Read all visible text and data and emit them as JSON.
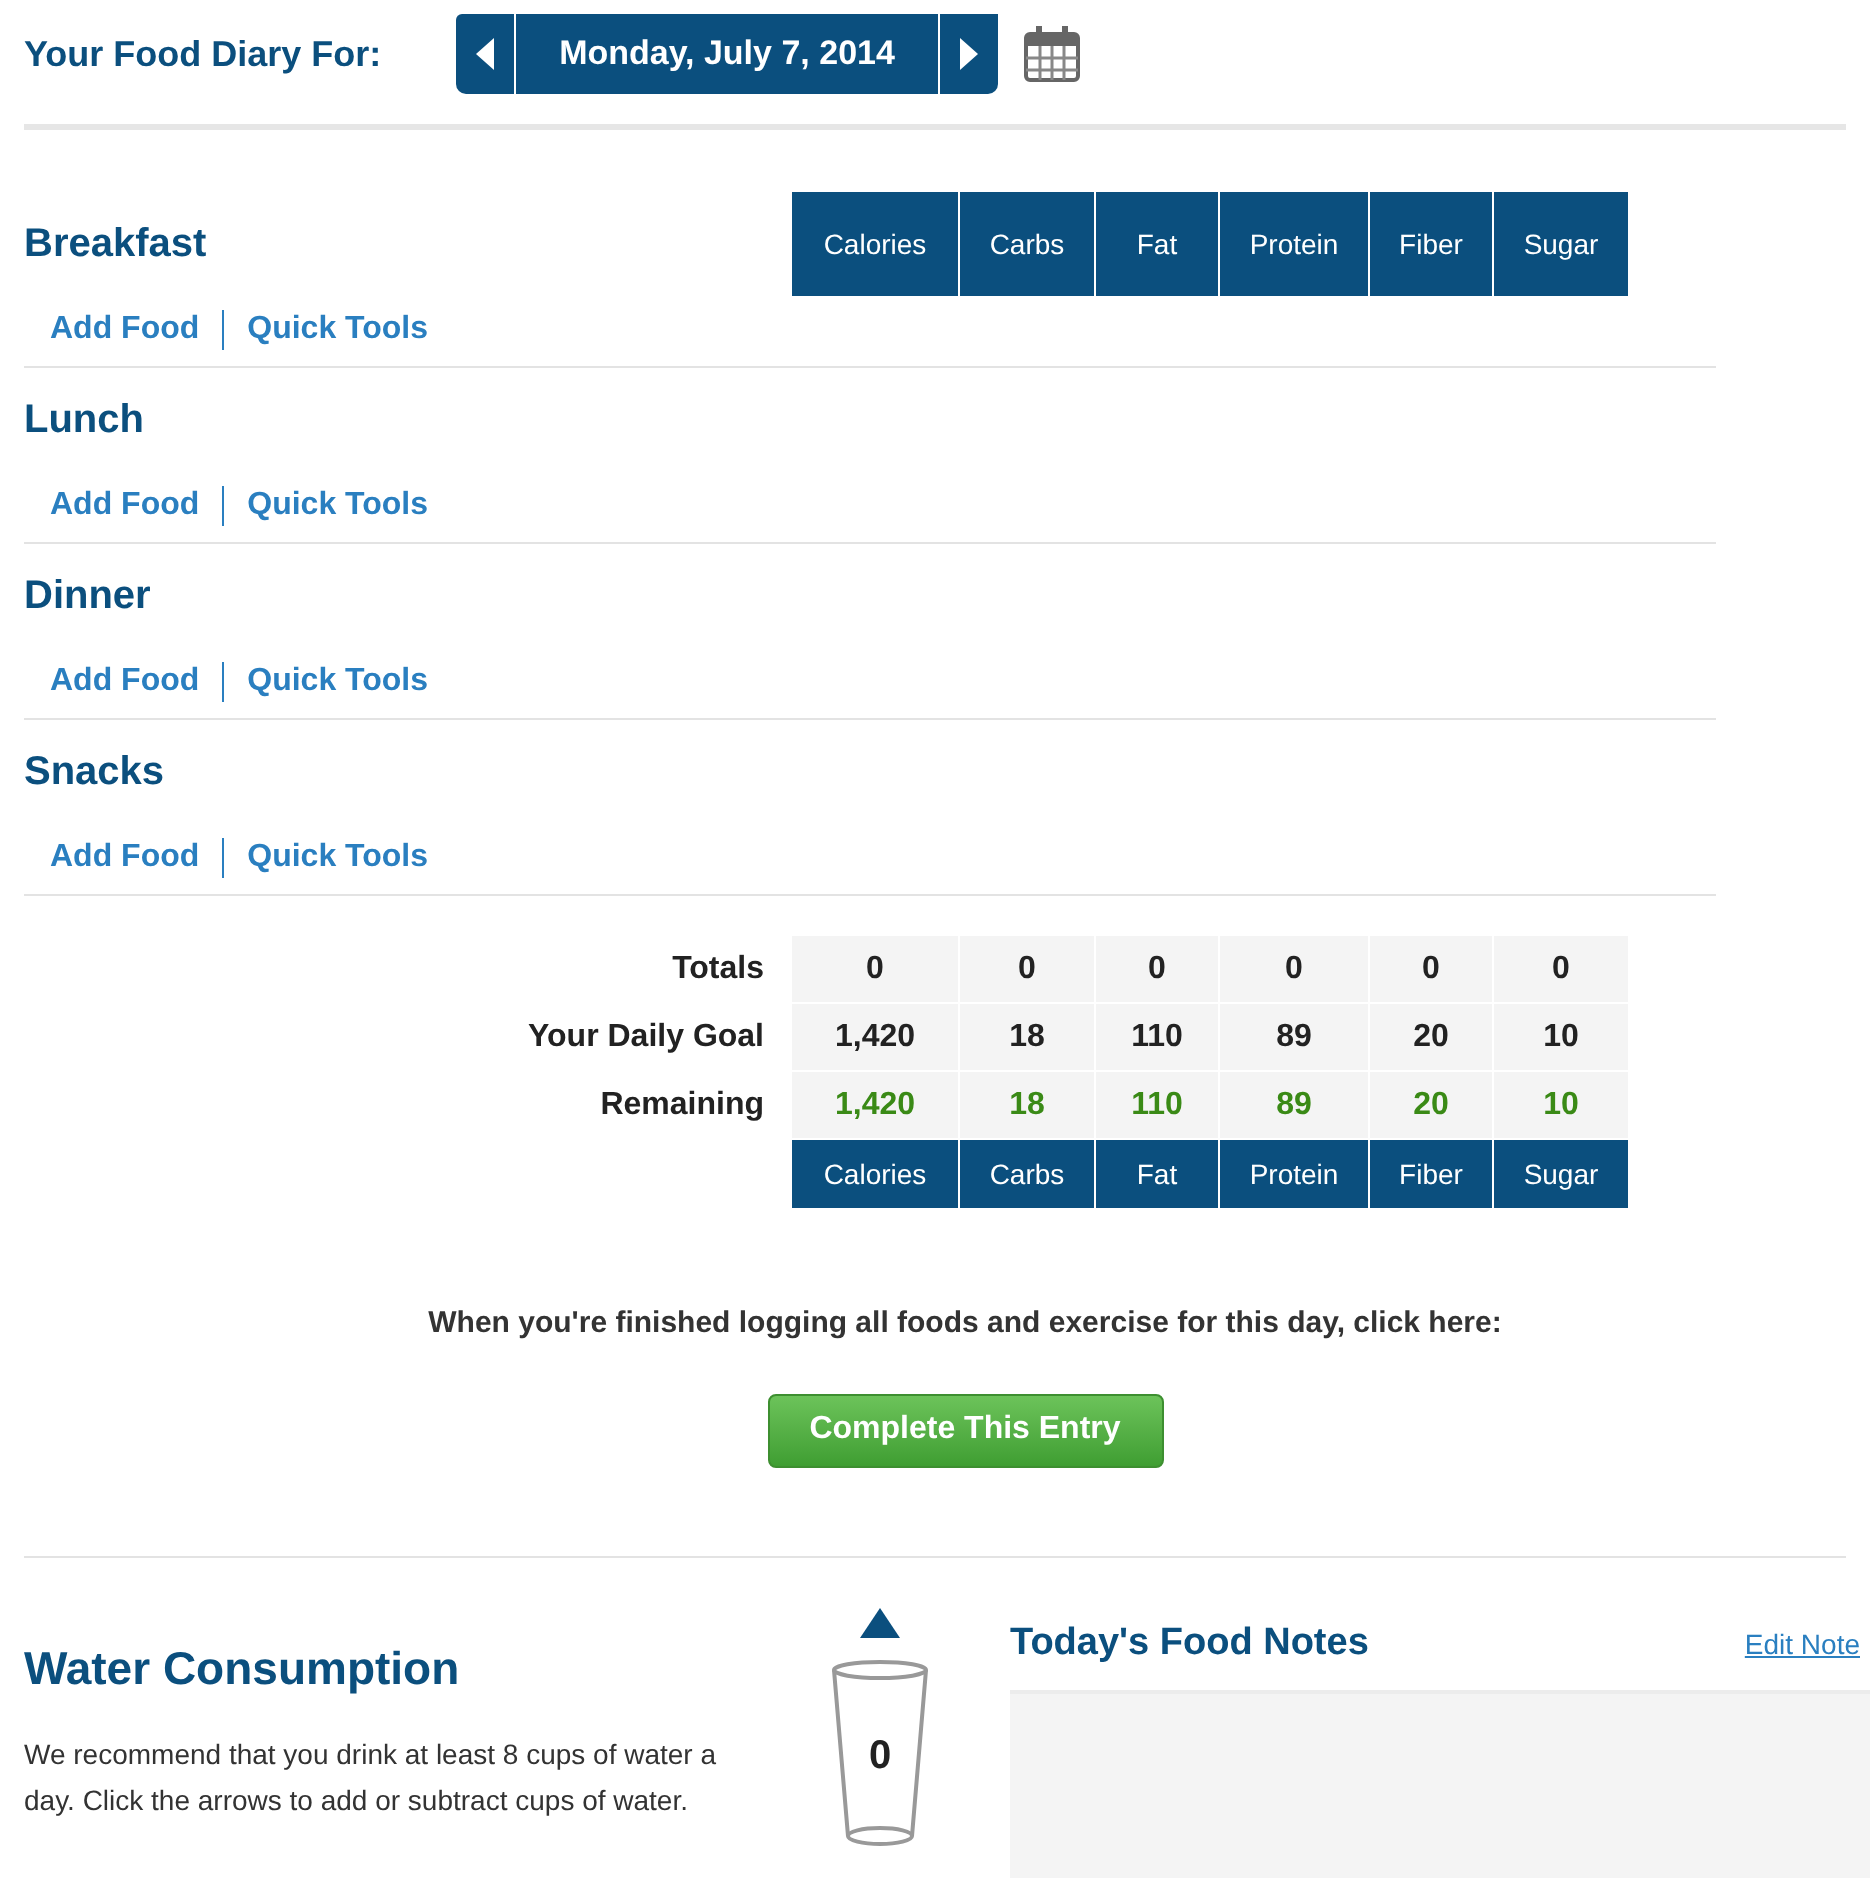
{
  "header": {
    "title": "Your Food Diary For:",
    "date": "Monday, July 7, 2014"
  },
  "top_columns": [
    "Calories",
    "Carbs",
    "Fat",
    "Protein",
    "Fiber",
    "Sugar"
  ],
  "meals": [
    {
      "name": "Breakfast",
      "links": [
        "Add Food",
        "Quick Tools"
      ]
    },
    {
      "name": "Lunch",
      "links": [
        "Add Food",
        "Quick Tools"
      ]
    },
    {
      "name": "Dinner",
      "links": [
        "Add Food",
        "Quick Tools"
      ]
    },
    {
      "name": "Snacks",
      "links": [
        "Add Food",
        "Quick Tools"
      ]
    }
  ],
  "summary_rows": [
    {
      "label": "Totals",
      "kind": "plain",
      "values": [
        "0",
        "0",
        "0",
        "0",
        "0",
        "0"
      ]
    },
    {
      "label": "Your Daily Goal",
      "kind": "plain",
      "values": [
        "1,420",
        "18",
        "110",
        "89",
        "20",
        "10"
      ]
    },
    {
      "label": "Remaining",
      "kind": "remaining",
      "values": [
        "1,420",
        "18",
        "110",
        "89",
        "20",
        "10"
      ]
    }
  ],
  "bottom_columns": [
    "Calories",
    "Carbs",
    "Fat",
    "Protein",
    "Fiber",
    "Sugar"
  ],
  "complete": {
    "message": "When you're finished logging all foods and exercise for this day, click here:",
    "button": "Complete This Entry"
  },
  "water": {
    "title": "Water Consumption",
    "text": "We recommend that you drink at least 8 cups of water a day. Click the arrows to add or subtract cups of water.",
    "cups": "0"
  },
  "notes": {
    "title": "Today's Food Notes",
    "edit_link": "Edit Note"
  }
}
